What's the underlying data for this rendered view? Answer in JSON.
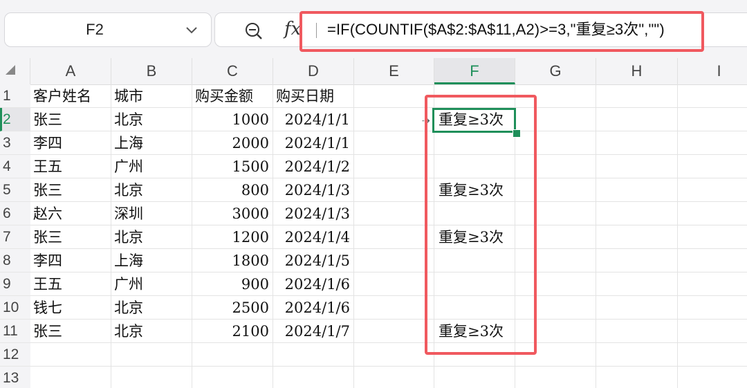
{
  "namebox": {
    "value": "F2",
    "icon": "chevron-down-icon"
  },
  "formula_bar": {
    "zoom_icon": "zoom-out-icon",
    "fx_label": "fx",
    "formula": "=IF(COUNTIF($A$2:$A$11,A2)>=3,\"重复≥3次\",\"\")",
    "highlight_color": "#f0595f"
  },
  "grid": {
    "accent_color": "#1f8f5a",
    "active_cell": "F2",
    "columns": [
      "A",
      "B",
      "C",
      "D",
      "E",
      "F",
      "G",
      "H",
      "I"
    ],
    "rows": [
      "1",
      "2",
      "3",
      "4",
      "5",
      "6",
      "7",
      "8",
      "9",
      "10",
      "11",
      "12",
      "13"
    ],
    "header": [
      "客户姓名",
      "城市",
      "购买金额",
      "购买日期"
    ],
    "data": [
      {
        "name": "张三",
        "city": "北京",
        "amount": "1000",
        "date": "2024/1/1",
        "flag": "重复≥3次"
      },
      {
        "name": "李四",
        "city": "上海",
        "amount": "2000",
        "date": "2024/1/1",
        "flag": ""
      },
      {
        "name": "王五",
        "city": "广州",
        "amount": "1500",
        "date": "2024/1/2",
        "flag": ""
      },
      {
        "name": "张三",
        "city": "北京",
        "amount": "800",
        "date": "2024/1/3",
        "flag": "重复≥3次"
      },
      {
        "name": "赵六",
        "city": "深圳",
        "amount": "3000",
        "date": "2024/1/3",
        "flag": ""
      },
      {
        "name": "张三",
        "city": "北京",
        "amount": "1200",
        "date": "2024/1/4",
        "flag": "重复≥3次"
      },
      {
        "name": "李四",
        "city": "上海",
        "amount": "1800",
        "date": "2024/1/5",
        "flag": ""
      },
      {
        "name": "王五",
        "city": "广州",
        "amount": "900",
        "date": "2024/1/6",
        "flag": ""
      },
      {
        "name": "钱七",
        "city": "北京",
        "amount": "2500",
        "date": "2024/1/6",
        "flag": ""
      },
      {
        "name": "张三",
        "city": "北京",
        "amount": "2100",
        "date": "2024/1/7",
        "flag": "重复≥3次"
      }
    ]
  }
}
